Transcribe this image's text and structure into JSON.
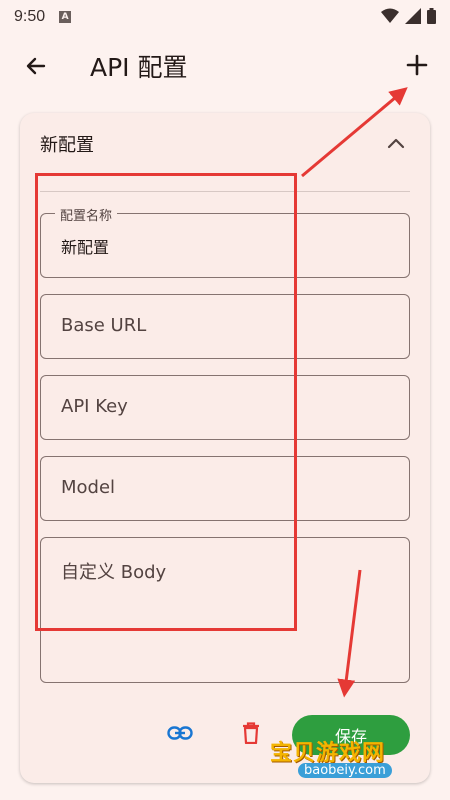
{
  "status_bar": {
    "time": "9:50",
    "notif_glyph": "A"
  },
  "app_bar": {
    "title": "API 配置"
  },
  "card": {
    "header": "新配置",
    "fields": {
      "name": {
        "label": "配置名称",
        "value": "新配置"
      },
      "base_url": {
        "placeholder": "Base URL"
      },
      "api_key": {
        "placeholder": "API Key"
      },
      "model": {
        "placeholder": "Model"
      },
      "custom_body": {
        "placeholder": "自定义 Body"
      }
    },
    "save_label": "保存"
  },
  "watermark": {
    "brand": "宝贝游戏网",
    "url": "baobeiy.com"
  },
  "colors": {
    "accent_green": "#2e9e3f",
    "link_blue": "#1976d2",
    "delete_red": "#e53935",
    "annotation_red": "#e53935"
  },
  "icons": [
    "arrow-left-icon",
    "plus-icon",
    "chevron-up-icon",
    "link-icon",
    "trash-icon",
    "wifi-icon",
    "signal-icon",
    "battery-icon"
  ]
}
